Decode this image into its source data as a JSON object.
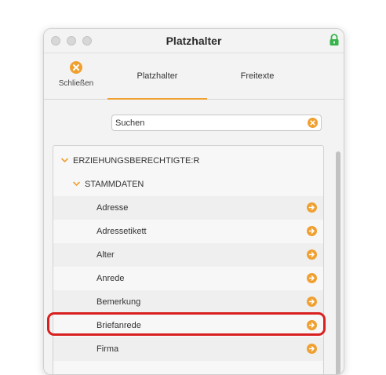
{
  "window": {
    "title": "Platzhalter"
  },
  "toolbar": {
    "close_label": "Schließen",
    "tabs": [
      {
        "label": "Platzhalter",
        "active": true
      },
      {
        "label": "Freitexte",
        "active": false
      }
    ]
  },
  "search": {
    "placeholder": "Suchen",
    "value": ""
  },
  "tree": {
    "groups": [
      {
        "label": "ERZIEHUNGSBERECHTIGTE:R",
        "expanded": true,
        "subgroups": [
          {
            "label": "STAMMDATEN",
            "expanded": true,
            "items": [
              {
                "label": "Adresse"
              },
              {
                "label": "Adressetikett"
              },
              {
                "label": "Alter"
              },
              {
                "label": "Anrede"
              },
              {
                "label": "Bemerkung"
              },
              {
                "label": "Briefanrede",
                "highlighted": true
              },
              {
                "label": "Firma"
              }
            ]
          }
        ]
      }
    ]
  },
  "colors": {
    "accent": "#f0a030",
    "highlight": "#d92020",
    "lock": "#36b34a"
  },
  "icons": {
    "close": "close-circle-icon",
    "clear": "clear-circle-icon",
    "expand": "chevron-down-icon",
    "go": "arrow-right-circle-icon",
    "lock": "lock-icon"
  }
}
